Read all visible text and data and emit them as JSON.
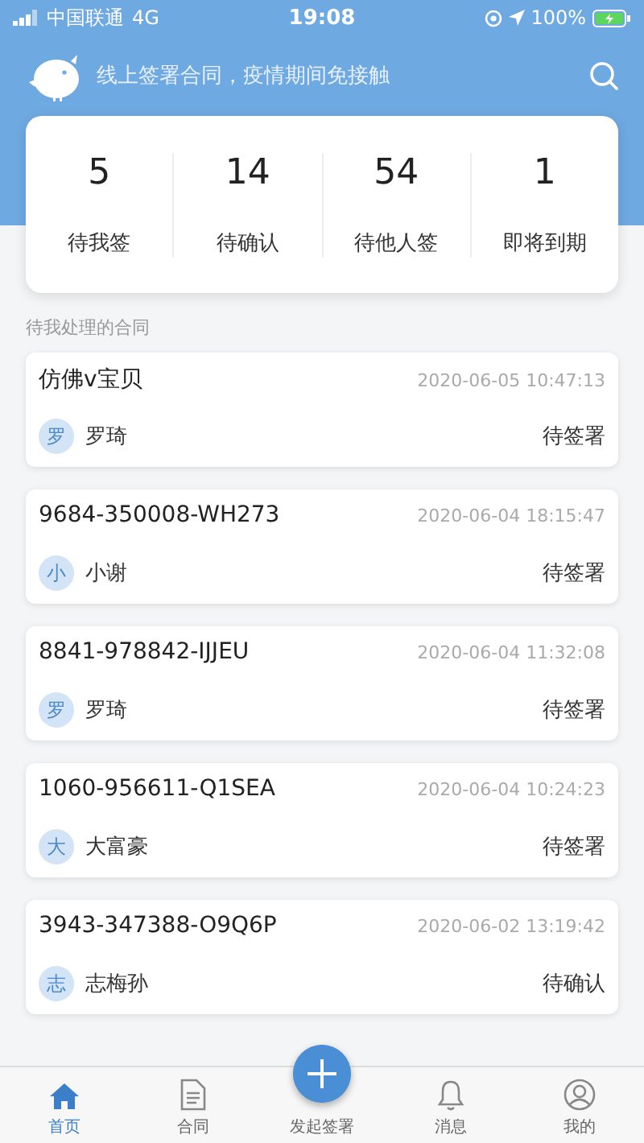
{
  "status_bar": {
    "carrier": "中国联通",
    "network": "4G",
    "time": "19:08",
    "battery": "100%"
  },
  "header": {
    "slogan": "线上签署合同，疫情期间免接触"
  },
  "stats": [
    {
      "count": "5",
      "label": "待我签"
    },
    {
      "count": "14",
      "label": "待确认"
    },
    {
      "count": "54",
      "label": "待他人签"
    },
    {
      "count": "1",
      "label": "即将到期"
    }
  ],
  "section_title": "待我处理的合同",
  "contracts": [
    {
      "title": "仿佛v宝贝",
      "time": "2020-06-05 10:47:13",
      "avatar": "罗",
      "person": "罗琦",
      "status": "待签署"
    },
    {
      "title": "9684-350008-WH273",
      "time": "2020-06-04 18:15:47",
      "avatar": "小",
      "person": "小谢",
      "status": "待签署"
    },
    {
      "title": "8841-978842-IJJEU",
      "time": "2020-06-04 11:32:08",
      "avatar": "罗",
      "person": "罗琦",
      "status": "待签署"
    },
    {
      "title": "1060-956611-Q1SEA",
      "time": "2020-06-04 10:24:23",
      "avatar": "大",
      "person": "大富豪",
      "status": "待签署"
    },
    {
      "title": "3943-347388-O9Q6P",
      "time": "2020-06-02 13:19:42",
      "avatar": "志",
      "person": "志梅孙",
      "status": "待确认"
    }
  ],
  "tab_bar": [
    {
      "kind": "home",
      "label": "首页",
      "selected": true
    },
    {
      "kind": "document",
      "label": "合同",
      "selected": false
    },
    {
      "kind": "fab",
      "label": "发起签署",
      "selected": false
    },
    {
      "kind": "bell",
      "label": "消息",
      "selected": false
    },
    {
      "kind": "person",
      "label": "我的",
      "selected": false
    }
  ]
}
